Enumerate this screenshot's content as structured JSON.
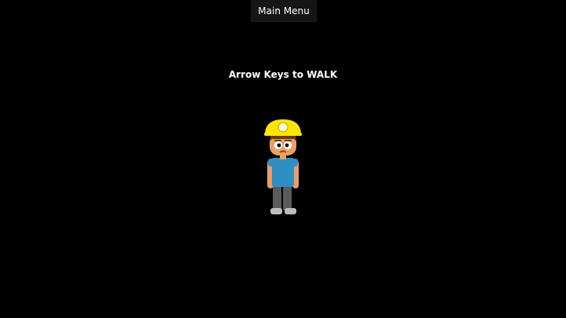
{
  "menu": {
    "main_menu_label": "Main Menu"
  },
  "hud": {
    "instruction": "Arrow Keys to WALK"
  },
  "player": {
    "sprite": "miner-character"
  },
  "colors": {
    "background": "#000000",
    "menu_button": "#161616",
    "text": "#ffffff",
    "helmet": "#ffe600",
    "helmet_lamp": "#fff6b0",
    "skin": "#e8a064",
    "hair": "#6b3a1c",
    "shirt": "#2f8fc4",
    "pants": "#5b5b5b",
    "shoes": "#bdbdbd"
  }
}
